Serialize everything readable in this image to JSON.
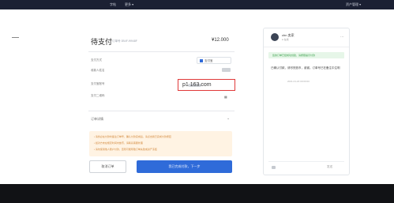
{
  "topbar": {
    "nav_primary": "字帖",
    "nav_secondary": "更多",
    "account_label": "资产管理"
  },
  "order": {
    "title": "待支付",
    "order_no": "订单号 0B4F-f9948F",
    "amount": "¥12.000",
    "rows": {
      "payment_method_label": "支付方式",
      "payment_method_value": "支付宝",
      "payee_name_label": "收款人姓名",
      "account_label": "支付宝账号",
      "account_value": "p1      163.com",
      "qr_label": "支付二维码",
      "qr_icon_name": "qr-code-icon"
    },
    "details_label": "订单详情",
    "notice_lines": [
      "• 请务必在付款时备注订单号，确认付款完成后，请点击我已完成付款按钮",
      "• 如对方未在规定时间内放币，请联系客服处理",
      "• 请勿使用他人账户付款，否则可能导致订单失败或资产冻结"
    ],
    "cancel_label": "取消订单",
    "confirm_label": "我已完成付款，下一步"
  },
  "chat": {
    "user_name": "chn 卖家",
    "user_status": "● 在线",
    "success_notice": "您的订单已经成功创建，请按照提示付款",
    "messages": [
      {
        "text": "已确认付款，请尽快放币，谢谢。订单号已在备注中注明",
        "time": "2021-01-20 00:00:00"
      }
    ],
    "send_label": "发送"
  },
  "colors": {
    "topbar": "#1b2033",
    "accent": "#2f6bd9",
    "highlight": "#e03a3a",
    "notice_bg": "#fff3e3",
    "success": "#3aa04b"
  }
}
